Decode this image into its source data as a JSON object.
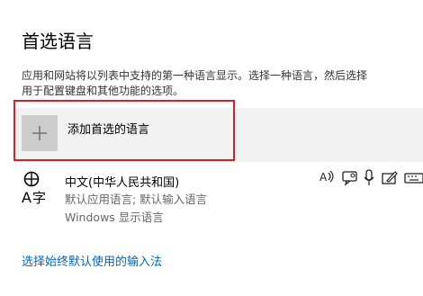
{
  "page": {
    "title": "首选语言",
    "description_line1": "应用和网站将以列表中支持的第一种语言显示。选择一种语言，然后选择",
    "description_line2": "用于配置键盘和其他功能的选项。"
  },
  "add_language": {
    "label": "添加首选的语言",
    "icon": "plus-icon"
  },
  "language": {
    "name": "中文(中华人民共和国)",
    "details": [
      "默认应用语言; 默认输入语言",
      "Windows 显示语言"
    ],
    "features": [
      "text-to-speech-icon",
      "speech-recognition-icon",
      "microphone-icon",
      "handwriting-icon",
      "keyboard-icon"
    ]
  },
  "input_method_link": "选择始终默认使用的输入法",
  "colors": {
    "highlight": "#d3202b",
    "link": "#0067b8"
  }
}
